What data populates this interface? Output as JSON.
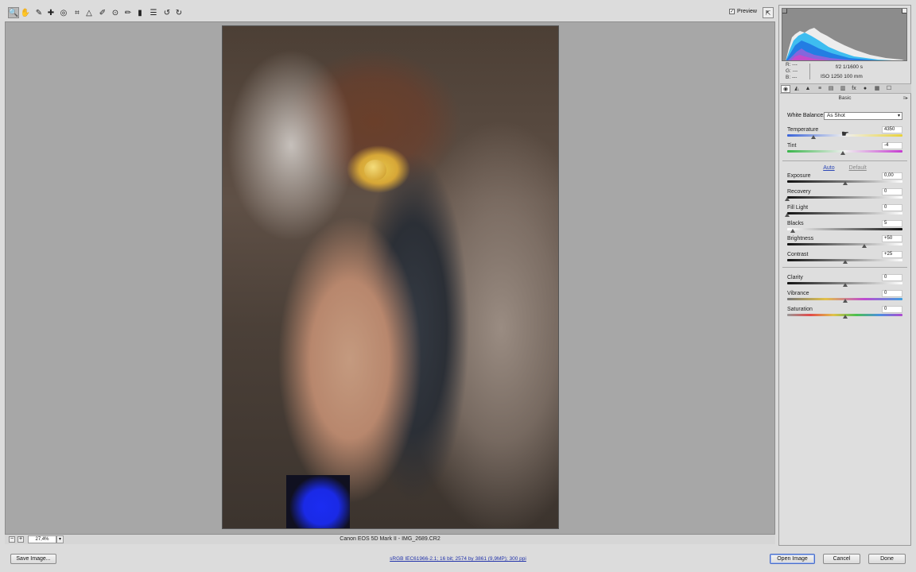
{
  "toolbar": {
    "tools": [
      {
        "name": "zoom-tool-icon",
        "glyph": "🔍"
      },
      {
        "name": "hand-tool-icon",
        "glyph": "✋"
      },
      {
        "name": "white-balance-tool-icon",
        "glyph": "✎"
      },
      {
        "name": "color-sampler-tool-icon",
        "glyph": "✚"
      },
      {
        "name": "target-adjustment-tool-icon",
        "glyph": "◎"
      },
      {
        "name": "crop-tool-icon",
        "glyph": "⌗"
      },
      {
        "name": "straighten-tool-icon",
        "glyph": "△"
      },
      {
        "name": "spot-removal-tool-icon",
        "glyph": "✐"
      },
      {
        "name": "red-eye-tool-icon",
        "glyph": "⊙"
      },
      {
        "name": "adjustment-brush-icon",
        "glyph": "✏"
      },
      {
        "name": "graduated-filter-icon",
        "glyph": "▮"
      },
      {
        "name": "preferences-icon",
        "glyph": "☰"
      },
      {
        "name": "rotate-ccw-icon",
        "glyph": "↺"
      },
      {
        "name": "rotate-cw-icon",
        "glyph": "↻"
      }
    ],
    "preview_label": "Preview",
    "preview_checked": "✓",
    "fullscreen_glyph": "⇱"
  },
  "zoom": {
    "minus": "−",
    "plus": "+",
    "value": "27,4%",
    "dropdown": "▾"
  },
  "file_title": "Canon EOS 5D Mark II  -  IMG_2689.CR2",
  "info": {
    "r": "R:   ---",
    "g": "G:   ---",
    "b": "B:   ---",
    "aperture_shutter": "f/2   1/1600 s",
    "iso_focal": "ISO 1250    100 mm"
  },
  "panel": {
    "tabs": [
      "◉",
      "◭",
      "▲",
      "≡",
      "▤",
      "▥",
      "fx",
      "●",
      "▦",
      "☐"
    ],
    "section_title": "Basic",
    "section_menu": "≡▸",
    "white_balance_label": "White Balance:",
    "white_balance_value": "As Shot",
    "white_balance_arrow": "▾",
    "auto_label": "Auto",
    "default_label": "Default",
    "sliders": [
      {
        "label": "Temperature",
        "value": "4350",
        "position": 0.23
      },
      {
        "label": "Tint",
        "value": "-4",
        "position": 0.48
      },
      {
        "label": "Exposure",
        "value": "0,00",
        "position": 0.5
      },
      {
        "label": "Recovery",
        "value": "0",
        "position": 0.0
      },
      {
        "label": "Fill Light",
        "value": "0",
        "position": 0.0
      },
      {
        "label": "Blacks",
        "value": "5",
        "position": 0.05
      },
      {
        "label": "Brightness",
        "value": "+50",
        "position": 0.67
      },
      {
        "label": "Contrast",
        "value": "+25",
        "position": 0.5
      },
      {
        "label": "Clarity",
        "value": "0",
        "position": 0.5
      },
      {
        "label": "Vibrance",
        "value": "0",
        "position": 0.5
      },
      {
        "label": "Saturation",
        "value": "0",
        "position": 0.5
      }
    ]
  },
  "bottom": {
    "save_label": "Save Image...",
    "workflow_text": "sRGB IEC61966-2.1; 16 bit; 2574 by 3861 (9,9MP); 300 ppi",
    "open_label": "Open Image",
    "cancel_label": "Cancel",
    "done_label": "Done"
  },
  "colors": {
    "link": "#2b46b5",
    "primary_button_border": "#4a6ec9",
    "clipping_highlight": "#1b2cf2"
  }
}
